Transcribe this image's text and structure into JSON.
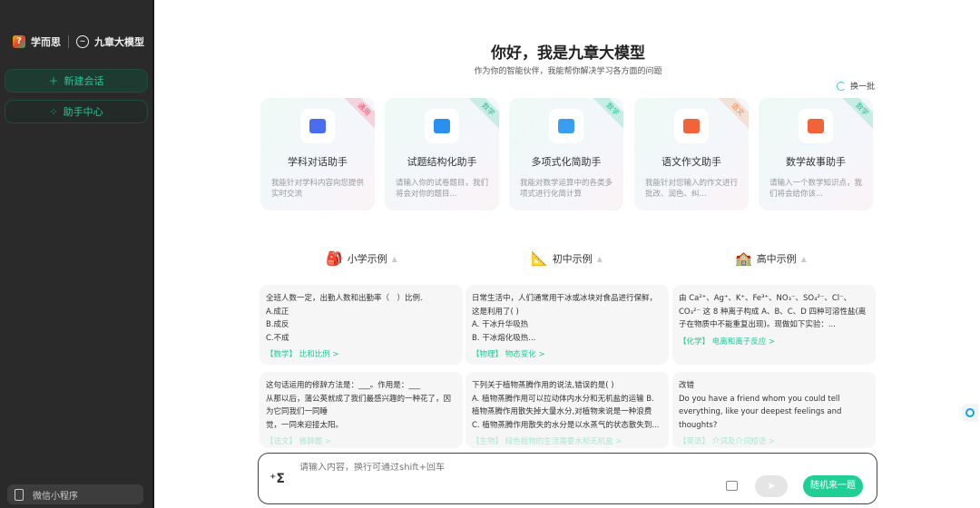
{
  "sidebar": {
    "brand1": "学而思",
    "brand2": "九章大模型",
    "new_chat": "新建会话",
    "helper_center": "助手中心",
    "mini_program": "微信小程序"
  },
  "header": {
    "title": "你好，我是九章大模型",
    "subtitle": "作为你的智能伙伴，我能帮你解决学习各方面的问题",
    "refresh": "换一批"
  },
  "cards": [
    {
      "tag": "通用",
      "tag_color": "#f0506e",
      "icon_color": "#4a6cf0",
      "title": "学科对话助手",
      "desc": "我能针对学科内容向您提供实时交流"
    },
    {
      "tag": "数学",
      "tag_color": "#1fc996",
      "icon_color": "#2b8ff0",
      "title": "试题结构化助手",
      "desc": "请输入你的试卷题目，我们将会对你的题目..."
    },
    {
      "tag": "数学",
      "tag_color": "#1fc996",
      "icon_color": "#3a9ef0",
      "title": "多项式化简助手",
      "desc": "我能对数学运算中的各类多项式进行化简计算"
    },
    {
      "tag": "语文",
      "tag_color": "#f58a4a",
      "icon_color": "#f2633a",
      "title": "语文作文助手",
      "desc": "我能针对您输入的作文进行批改、润色、纠..."
    },
    {
      "tag": "数学",
      "tag_color": "#1fc996",
      "icon_color": "#f2633a",
      "title": "数学故事助手",
      "desc": "请输入一个数学知识点，我们将会给你该..."
    }
  ],
  "columns": [
    {
      "title": "小学示例",
      "examples": [
        {
          "lines": [
            "全班人数一定，出勤人数和出勤率（　）比例.",
            "A.成正",
            "B.成反",
            "C.不成"
          ],
          "tag": "【数学】 比和比例 >"
        },
        {
          "lines": [
            "这句话运用的修辞方法是：___。作用是：___",
            "从那以后，蒲公英就成了我们最感兴趣的一种花了，因为它同我们一同睡",
            "觉，一同来迎接太阳。"
          ],
          "tag": "【语文】 修辞题 >"
        }
      ]
    },
    {
      "title": "初中示例",
      "examples": [
        {
          "lines": [
            "日常生活中，人们通常用干冰或冰块对食品进行保鲜，这是利用了( )",
            "A. 干冰升华吸热",
            "B. 干冰熔化吸热..."
          ],
          "tag": "【物理】 物态变化 >"
        },
        {
          "lines": [
            "下列关于植物蒸腾作用的说法,错误的是( )",
            "A. 植物蒸腾作用可以拉动体内水分和无机盐的运输 B. 植物蒸腾作用散失掉大量水分,对植物来说是一种浪费",
            "C. 植物蒸腾作用散失的水分是以水蒸气的状态散失到..."
          ],
          "tag": "【生物】 绿色植物的生活需要水和无机盐 >"
        }
      ]
    },
    {
      "title": "高中示例",
      "examples": [
        {
          "lines": [
            "由 Ca²⁺、Ag⁺、K⁺、Fe³⁺、NO₃⁻、SO₄²⁻、Cl⁻、CO₃²⁻ 这 8 种离子构成 A、B、C、D 四种可溶性盐(离子在物质中不能重复出现)。现做如下实验：..."
          ],
          "tag": "【化学】 电离和离子反应 >"
        },
        {
          "lines": [
            "改错",
            "Do you have a friend whom you could tell everything, like your deepest feelings and thoughts?"
          ],
          "tag": "【英语】 介词及介词短语 >"
        }
      ]
    }
  ],
  "input": {
    "placeholder": "请输入内容，换行可通过shift+回车",
    "sigma": "⁺Σ",
    "random": "随机来一题",
    "send": "➤"
  }
}
